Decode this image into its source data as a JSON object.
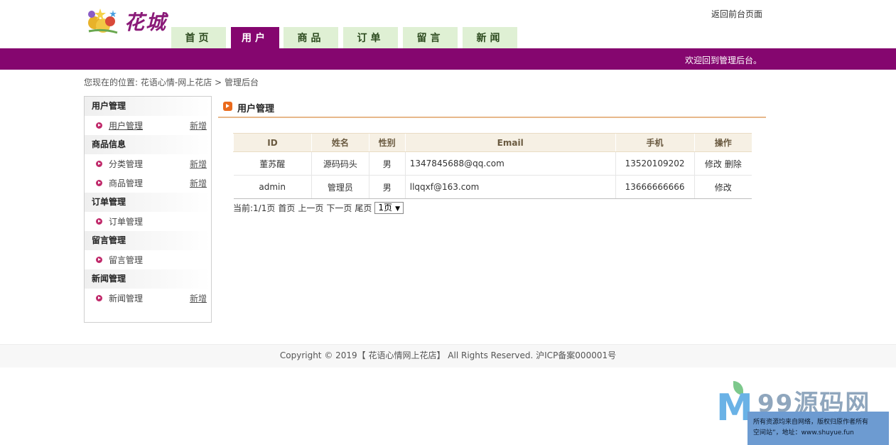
{
  "header": {
    "logo_text": "花城",
    "return_link": "返回前台页面"
  },
  "nav": {
    "tabs": [
      {
        "label": "首页",
        "active": false
      },
      {
        "label": "用户",
        "active": true
      },
      {
        "label": "商品",
        "active": false
      },
      {
        "label": "订单",
        "active": false
      },
      {
        "label": "留言",
        "active": false
      },
      {
        "label": "新闻",
        "active": false
      }
    ]
  },
  "welcome_text": "欢迎回到管理后台。",
  "breadcrumb": {
    "prefix": "您现在的位置:",
    "site": "花语心情-网上花店",
    "sep": ">",
    "current": "管理后台"
  },
  "sidebar": {
    "groups": [
      {
        "title": "用户管理",
        "items": [
          {
            "label": "用户管理",
            "add": "新增"
          }
        ]
      },
      {
        "title": "商品信息",
        "items": [
          {
            "label": "分类管理",
            "add": "新增"
          },
          {
            "label": "商品管理",
            "add": "新增"
          }
        ]
      },
      {
        "title": "订单管理",
        "items": [
          {
            "label": "订单管理",
            "add": ""
          }
        ]
      },
      {
        "title": "留言管理",
        "items": [
          {
            "label": "留言管理",
            "add": ""
          }
        ]
      },
      {
        "title": "新闻管理",
        "items": [
          {
            "label": "新闻管理",
            "add": "新增"
          }
        ]
      }
    ]
  },
  "main": {
    "title": "用户管理",
    "table": {
      "headers": [
        "ID",
        "姓名",
        "性别",
        "Email",
        "手机",
        "操作"
      ],
      "rows": [
        {
          "id": "董苏醒",
          "name": "源码码头",
          "gender": "男",
          "email": "1347845688@qq.com",
          "phone": "13520109202",
          "edit": "修改",
          "delete": "删除"
        },
        {
          "id": "admin",
          "name": "管理员",
          "gender": "男",
          "email": "llqqxf@163.com",
          "phone": "13666666666",
          "edit": "修改",
          "delete": ""
        }
      ]
    },
    "pager": {
      "current": "当前:1/1页",
      "first": "首页",
      "prev": "上一页",
      "next": "下一页",
      "last": "尾页",
      "select_value": "1页"
    }
  },
  "footer": {
    "text": "Copyright © 2019【 花语心情网上花店】 All Rights Reserved. 沪ICP备案000001号"
  },
  "watermark": {
    "title": "99源码网",
    "line1": "所有资源均来自网络，版权归原作者所有",
    "line2": "空间站”，地址：www.shuyue.fun"
  }
}
